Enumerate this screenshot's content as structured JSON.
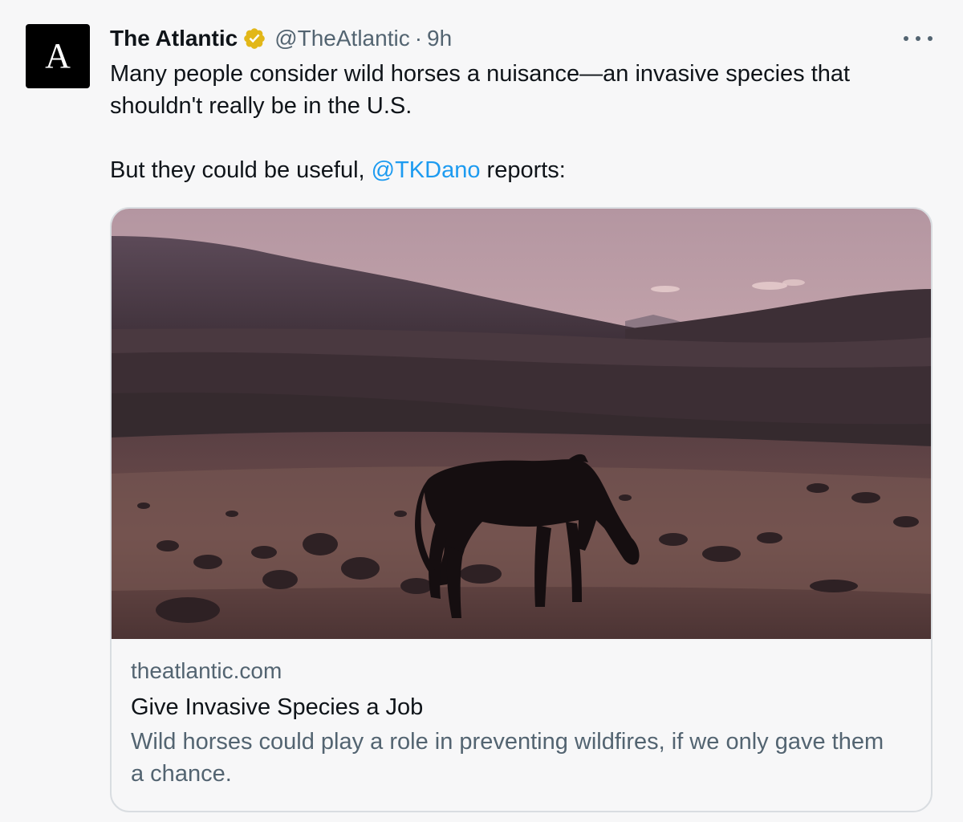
{
  "avatar": {
    "letter": "A",
    "background": "#000000"
  },
  "author": {
    "display_name": "The Atlantic",
    "verified_icon": "verified-gold-badge-icon",
    "verified_color": "#e2b719",
    "handle": "@TheAtlantic",
    "separator": "·",
    "timestamp": "9h"
  },
  "more_icon": "more-horizontal-icon",
  "tweet": {
    "line1": "Many people consider wild horses a nuisance—an invasive species that shouldn't really be in the U.S.",
    "line2_before": "But they could be useful, ",
    "mention": "@TKDano",
    "line2_after": " reports:",
    "mention_color": "#1d9bf0"
  },
  "card": {
    "image": "silhouette-of-wild-horse-grazing-at-dusk",
    "domain": "theatlantic.com",
    "title": "Give Invasive Species a Job",
    "description": "Wild horses could play a role in preventing wildfires, if we only gave them a chance."
  }
}
